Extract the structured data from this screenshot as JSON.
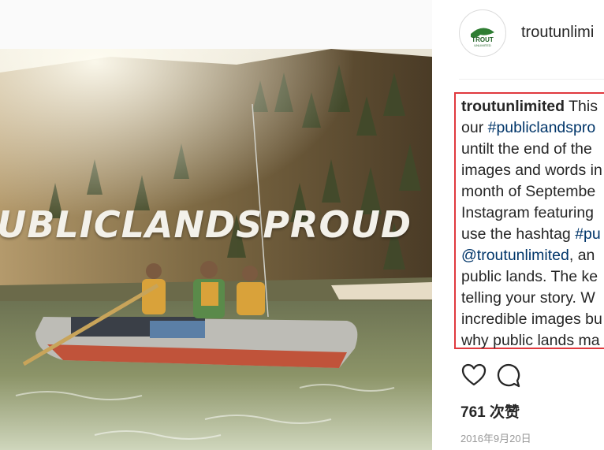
{
  "image": {
    "overlay_text": "UBLICLANDSPROUD"
  },
  "profile": {
    "avatar_text_top": "TROUT",
    "avatar_text_bottom": "UNLIMITED",
    "username": "troutunlimi"
  },
  "caption": {
    "lines": [
      {
        "user": "troutunlimited",
        "text": " This"
      },
      {
        "text": "our ",
        "tag": "#publiclandspro"
      },
      {
        "text": "untilt the end of the"
      },
      {
        "text": "images and words in"
      },
      {
        "text": "month of Septembe"
      },
      {
        "text": "Instagram featuring"
      },
      {
        "text": "use the hashtag ",
        "tag": "#pu"
      },
      {
        "tag": "@troutunlimited",
        "text": ", an"
      },
      {
        "text": "public lands. The ke"
      },
      {
        "text": "telling your story. W"
      },
      {
        "text": "incredible images bu"
      },
      {
        "text": "why public lands ma"
      }
    ]
  },
  "actions": {
    "like_icon": "heart-icon",
    "comment_icon": "comment-icon"
  },
  "stats": {
    "likes": "761 次赞",
    "date": "2016年9月20日"
  },
  "colors": {
    "highlight_border": "#e0393e",
    "link": "#003569",
    "accent_green": "#2e7d32"
  }
}
